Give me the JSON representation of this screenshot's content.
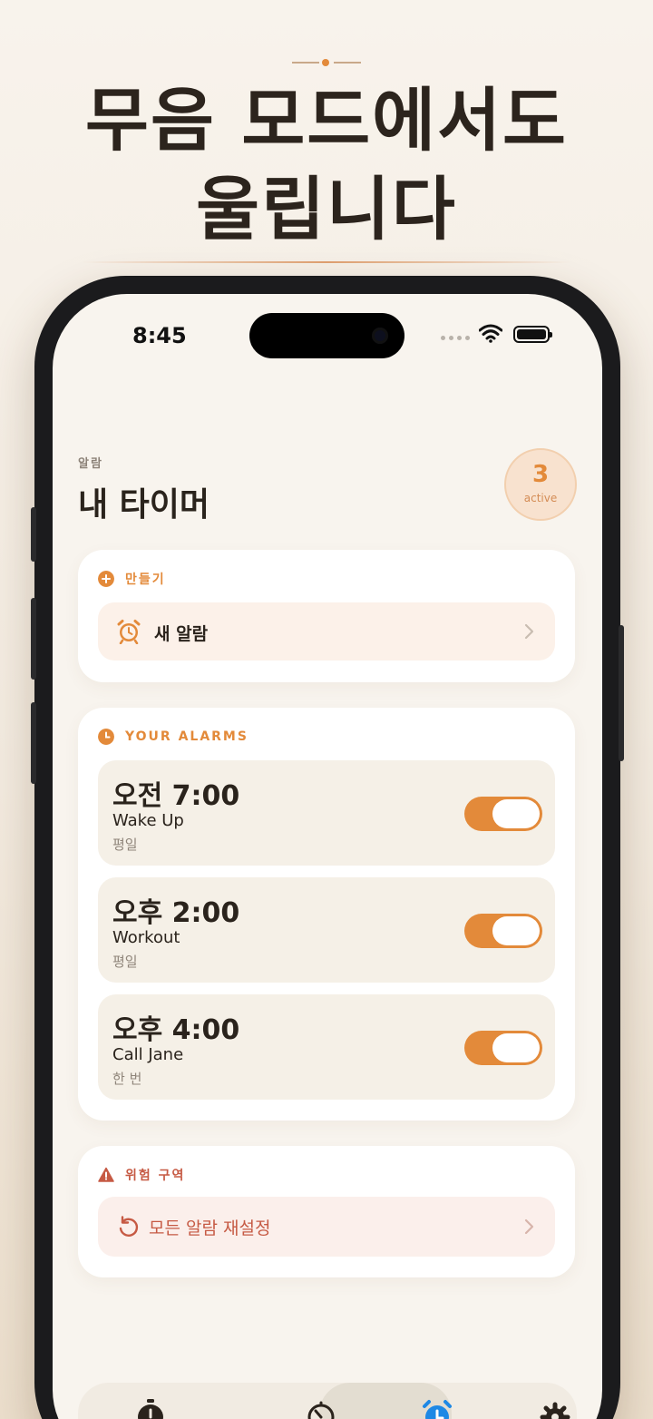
{
  "headline": {
    "line1": "무음 모드에서도",
    "line2": "울립니다"
  },
  "status_bar": {
    "time": "8:45"
  },
  "header": {
    "subtitle": "알람",
    "title": "내 타이머",
    "active_count": "3",
    "active_label": "active"
  },
  "create_section": {
    "label": "만들기",
    "new_alarm_label": "새 알람"
  },
  "alarms_section": {
    "label": "YOUR ALARMS",
    "items": [
      {
        "time": "오전 7:00",
        "name": "Wake Up",
        "repeat": "평일",
        "enabled": true
      },
      {
        "time": "오후 2:00",
        "name": "Workout",
        "repeat": "평일",
        "enabled": true
      },
      {
        "time": "오후 4:00",
        "name": "Call Jane",
        "repeat": "한 번",
        "enabled": true
      }
    ]
  },
  "danger_section": {
    "label": "위험 구역",
    "reset_label": "모든 알람 재설정"
  },
  "tabbar": {
    "tabs": [
      {
        "icon": "stopwatch-icon"
      },
      {
        "icon": "timer-icon"
      },
      {
        "icon": "alarm-clock-icon",
        "active": true
      },
      {
        "icon": "gear-icon"
      }
    ]
  },
  "colors": {
    "accent": "#e38a3a",
    "danger": "#c65a44",
    "tab_active": "#1e88e5"
  }
}
